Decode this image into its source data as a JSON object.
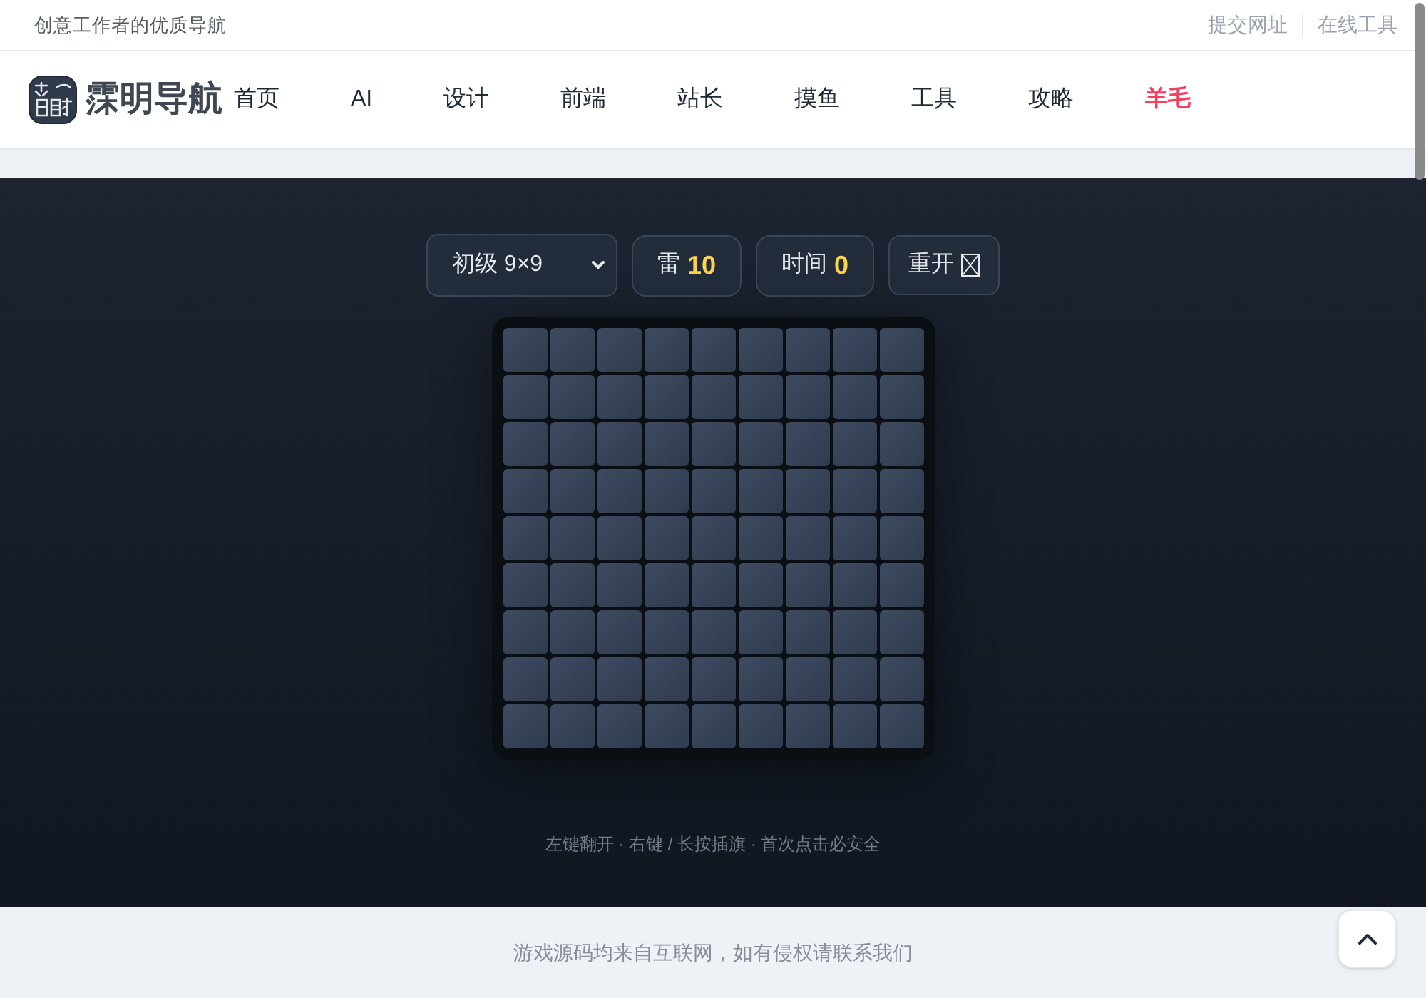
{
  "top_bar": {
    "tagline": "创意工作者的优质导航",
    "links": [
      "提交网址",
      "在线工具"
    ]
  },
  "nav": {
    "brand": "霂明导航",
    "items": [
      {
        "label": "首页",
        "highlighted": false
      },
      {
        "label": "AI",
        "highlighted": false
      },
      {
        "label": "设计",
        "highlighted": false
      },
      {
        "label": "前端",
        "highlighted": false
      },
      {
        "label": "站长",
        "highlighted": false
      },
      {
        "label": "摸鱼",
        "highlighted": false
      },
      {
        "label": "工具",
        "highlighted": false
      },
      {
        "label": "攻略",
        "highlighted": false
      },
      {
        "label": "羊毛",
        "highlighted": true
      }
    ]
  },
  "game": {
    "difficulty": {
      "value": "初级 9×9"
    },
    "mines": {
      "label": "雷",
      "value": "10"
    },
    "timer": {
      "label": "时间",
      "value": "0"
    },
    "restart": {
      "label": "重开"
    },
    "board": {
      "rows": [
        {
          "cells": [
            {
              "revealed": false
            },
            {
              "revealed": false
            },
            {
              "revealed": false
            },
            {
              "revealed": false
            },
            {
              "revealed": false
            },
            {
              "revealed": false
            },
            {
              "revealed": false
            },
            {
              "revealed": false
            },
            {
              "revealed": false
            }
          ]
        },
        {
          "cells": [
            {
              "revealed": false
            },
            {
              "revealed": false
            },
            {
              "revealed": false
            },
            {
              "revealed": false
            },
            {
              "revealed": false
            },
            {
              "revealed": false
            },
            {
              "revealed": false
            },
            {
              "revealed": false
            },
            {
              "revealed": false
            }
          ]
        },
        {
          "cells": [
            {
              "revealed": false
            },
            {
              "revealed": false
            },
            {
              "revealed": false
            },
            {
              "revealed": false
            },
            {
              "revealed": false
            },
            {
              "revealed": false
            },
            {
              "revealed": false
            },
            {
              "revealed": false
            },
            {
              "revealed": false
            }
          ]
        },
        {
          "cells": [
            {
              "revealed": false
            },
            {
              "revealed": false
            },
            {
              "revealed": false
            },
            {
              "revealed": false
            },
            {
              "revealed": false
            },
            {
              "revealed": false
            },
            {
              "revealed": false
            },
            {
              "revealed": false
            },
            {
              "revealed": false
            }
          ]
        },
        {
          "cells": [
            {
              "revealed": false
            },
            {
              "revealed": false
            },
            {
              "revealed": false
            },
            {
              "revealed": false
            },
            {
              "revealed": false
            },
            {
              "revealed": false
            },
            {
              "revealed": false
            },
            {
              "revealed": false
            },
            {
              "revealed": false
            }
          ]
        },
        {
          "cells": [
            {
              "revealed": false
            },
            {
              "revealed": false
            },
            {
              "revealed": false
            },
            {
              "revealed": false
            },
            {
              "revealed": false
            },
            {
              "revealed": false
            },
            {
              "revealed": false
            },
            {
              "revealed": false
            },
            {
              "revealed": false
            }
          ]
        },
        {
          "cells": [
            {
              "revealed": false
            },
            {
              "revealed": false
            },
            {
              "revealed": false
            },
            {
              "revealed": false
            },
            {
              "revealed": false
            },
            {
              "revealed": false
            },
            {
              "revealed": false
            },
            {
              "revealed": false
            },
            {
              "revealed": false
            }
          ]
        },
        {
          "cells": [
            {
              "revealed": false
            },
            {
              "revealed": false
            },
            {
              "revealed": false
            },
            {
              "revealed": false
            },
            {
              "revealed": false
            },
            {
              "revealed": false
            },
            {
              "revealed": false
            },
            {
              "revealed": false
            },
            {
              "revealed": false
            }
          ]
        },
        {
          "cells": [
            {
              "revealed": false
            },
            {
              "revealed": false
            },
            {
              "revealed": false
            },
            {
              "revealed": false
            },
            {
              "revealed": false
            },
            {
              "revealed": false
            },
            {
              "revealed": false
            },
            {
              "revealed": false
            },
            {
              "revealed": false
            }
          ]
        }
      ]
    },
    "hint": "左键翻开 · 右键 / 长按插旗 · 首次点击必安全"
  },
  "footer": {
    "notice": "游戏源码均来自互联网，如有侵权请联系我们"
  }
}
